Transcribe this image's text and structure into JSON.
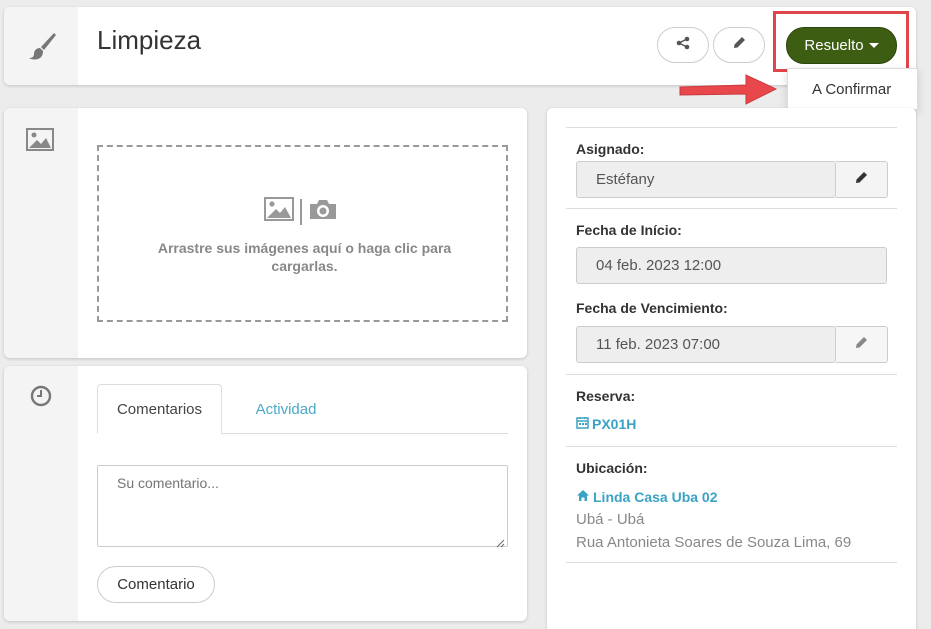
{
  "header": {
    "title": "Limpieza",
    "icon": "paintbrush-icon",
    "share_icon": "share-icon",
    "edit_icon": "pencil-icon",
    "status_button": "Resuelto",
    "status_color": "#3c5d12",
    "dropdown": {
      "items": [
        "A Confirmar"
      ]
    }
  },
  "annotation": {
    "highlight_color": "#e0454a",
    "arrow_color": "#e0454a"
  },
  "images": {
    "icon": "picture-icon",
    "dropzone_text": "Arrastre sus imágenes aquí o haga clic para cargarlas."
  },
  "comments": {
    "icon": "clock-icon",
    "tabs": [
      "Comentarios",
      "Actividad"
    ],
    "active_tab": "Comentarios",
    "placeholder": "Su comentario...",
    "submit_label": "Comentario",
    "link_color": "#4ba9c6"
  },
  "details": {
    "assigned": {
      "label": "Asignado:",
      "value": "Estéfany"
    },
    "start_date": {
      "label": "Fecha de Início:",
      "value": "04 feb. 2023 12:00"
    },
    "due_date": {
      "label": "Fecha de Vencimiento:",
      "value": "11 feb. 2023 07:00"
    },
    "reservation": {
      "label": "Reserva:",
      "value": "PX01H",
      "icon": "calendar-icon"
    },
    "location": {
      "label": "Ubicación:",
      "name": "Linda Casa Uba 02",
      "icon": "home-icon",
      "city": "Ubá - Ubá",
      "address": "Rua Antonieta Soares de Souza Lima, 69"
    }
  }
}
